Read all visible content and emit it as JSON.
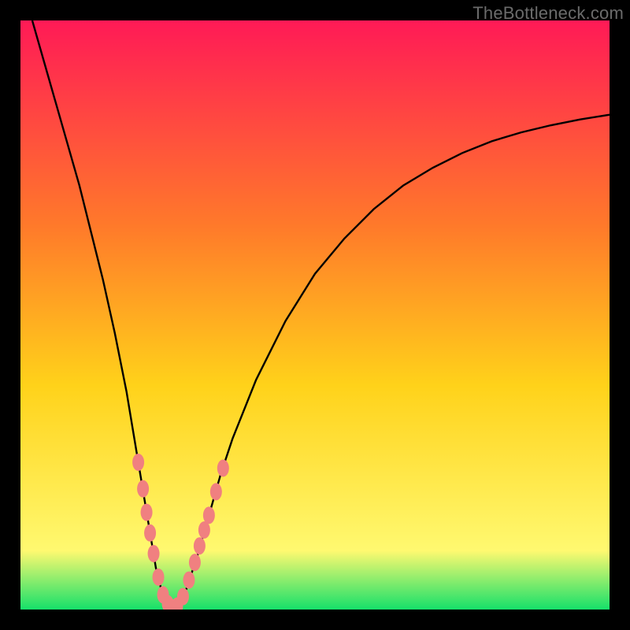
{
  "watermark": "TheBottleneck.com",
  "colors": {
    "gradient_top": "#ff1a56",
    "gradient_mid1": "#ff7a2a",
    "gradient_mid2": "#ffd21a",
    "gradient_mid3": "#fff970",
    "gradient_bottom": "#16e06a",
    "curve": "#000000",
    "marker": "#f08080",
    "frame": "#000000"
  },
  "chart_data": {
    "type": "line",
    "title": "",
    "xlabel": "",
    "ylabel": "",
    "xlim": [
      0,
      100
    ],
    "ylim": [
      0,
      100
    ],
    "series": [
      {
        "name": "bottleneck-curve",
        "x": [
          2,
          4,
          6,
          8,
          10,
          12,
          14,
          16,
          18,
          20,
          21,
          22,
          23,
          24,
          25,
          26,
          27,
          28,
          30,
          32,
          34,
          36,
          38,
          40,
          45,
          50,
          55,
          60,
          65,
          70,
          75,
          80,
          85,
          90,
          95,
          100
        ],
        "y": [
          100,
          93,
          86,
          79,
          72,
          64,
          56,
          47,
          37,
          25,
          19,
          13,
          7,
          3,
          1,
          0,
          1,
          3,
          9,
          16,
          23,
          29,
          34,
          39,
          49,
          57,
          63,
          68,
          72,
          75,
          77.5,
          79.5,
          81,
          82.2,
          83.2,
          84
        ]
      }
    ],
    "markers": {
      "name": "highlighted-points",
      "points": [
        {
          "x": 20.0,
          "y": 25.0
        },
        {
          "x": 20.8,
          "y": 20.5
        },
        {
          "x": 21.4,
          "y": 16.5
        },
        {
          "x": 22.0,
          "y": 13.0
        },
        {
          "x": 22.6,
          "y": 9.5
        },
        {
          "x": 23.4,
          "y": 5.5
        },
        {
          "x": 24.2,
          "y": 2.5
        },
        {
          "x": 25.0,
          "y": 1.0
        },
        {
          "x": 25.8,
          "y": 0.3
        },
        {
          "x": 26.6,
          "y": 0.6
        },
        {
          "x": 27.6,
          "y": 2.2
        },
        {
          "x": 28.6,
          "y": 5.0
        },
        {
          "x": 29.6,
          "y": 8.0
        },
        {
          "x": 30.4,
          "y": 10.8
        },
        {
          "x": 31.2,
          "y": 13.5
        },
        {
          "x": 32.0,
          "y": 16.0
        },
        {
          "x": 33.2,
          "y": 20.0
        },
        {
          "x": 34.4,
          "y": 24.0
        }
      ]
    }
  }
}
